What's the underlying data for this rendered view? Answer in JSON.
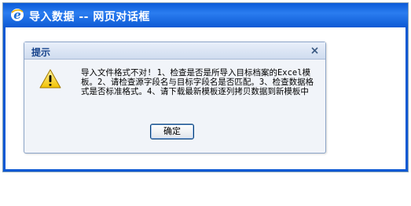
{
  "outer_window": {
    "title": "导入数据 -- 网页对话框",
    "icon": "internet-explorer-icon",
    "titlebar_color": "#0c59d4"
  },
  "dialog": {
    "title": "提示",
    "close_icon": "close-icon",
    "warning_icon": "warning-icon",
    "message": "导入文件格式不对! 1、检查是否是所导入目标档案的Excel模板。2、请检查源字段名与目标字段名是否匹配。3、检查数据格式是否标准格式。4、请下载最新模板逐列拷贝数据到新模板中",
    "ok_label": "确定"
  }
}
